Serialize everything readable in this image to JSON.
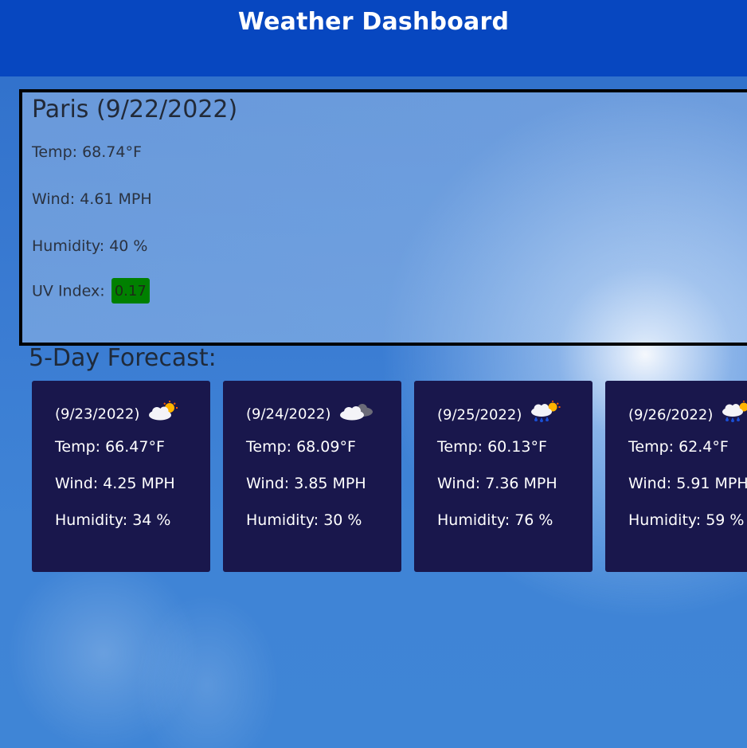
{
  "header": {
    "title": "Weather Dashboard"
  },
  "current": {
    "title": "Paris (9/22/2022)",
    "temp": "Temp: 68.74°F",
    "wind": "Wind: 4.61 MPH",
    "humidity": "Humidity: 40 %",
    "uv_label": "UV Index:",
    "uv_value": "0.17",
    "uv_color": "#008000"
  },
  "forecast": {
    "heading": "5-Day Forecast:",
    "cards": [
      {
        "date": "(9/23/2022)",
        "icon": "partly-cloudy-sun-icon",
        "temp": "Temp: 66.47°F",
        "wind": "Wind: 4.25 MPH",
        "humidity": "Humidity: 34 %"
      },
      {
        "date": "(9/24/2022)",
        "icon": "cloud-night-icon",
        "temp": "Temp: 68.09°F",
        "wind": "Wind: 3.85 MPH",
        "humidity": "Humidity: 30 %"
      },
      {
        "date": "(9/25/2022)",
        "icon": "rain-sun-icon",
        "temp": "Temp: 60.13°F",
        "wind": "Wind: 7.36 MPH",
        "humidity": "Humidity: 76 %"
      },
      {
        "date": "(9/26/2022)",
        "icon": "rain-sun-icon",
        "temp": "Temp: 62.4°F",
        "wind": "Wind: 5.91 MPH",
        "humidity": "Humidity: 59 %"
      }
    ]
  },
  "colors": {
    "header_bg": "#0747c0",
    "card_bg": "#19174c",
    "uv_low": "#008000"
  }
}
